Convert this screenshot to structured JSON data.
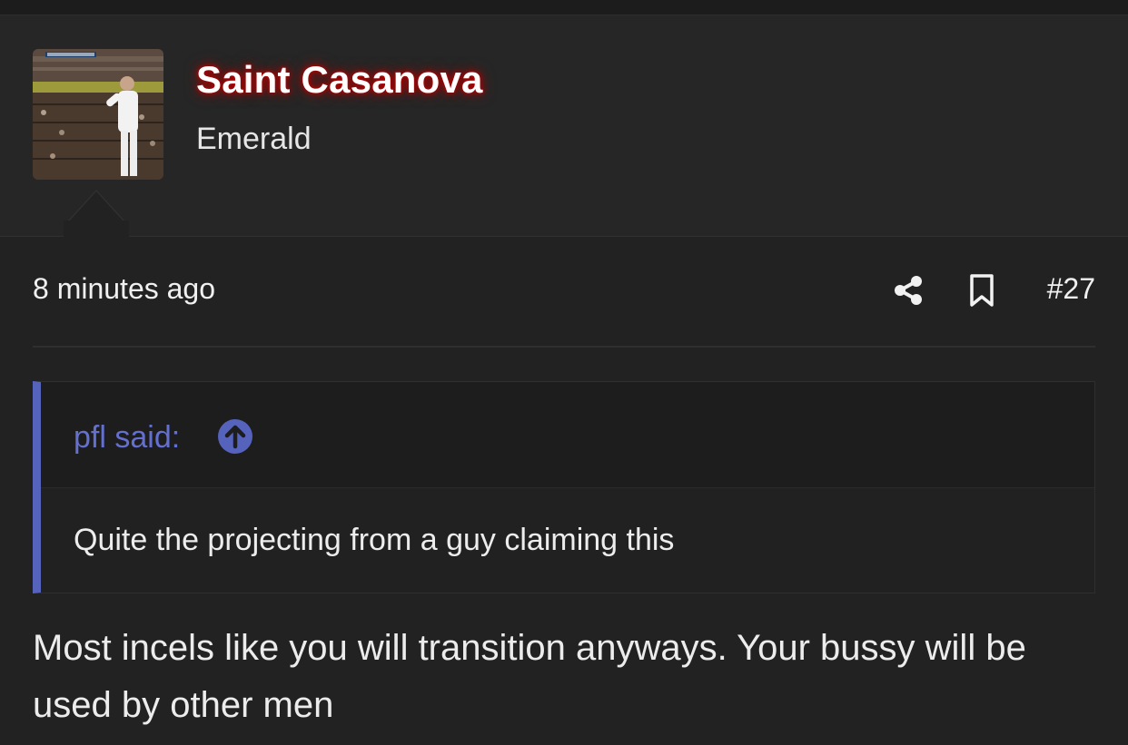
{
  "user": {
    "name": "Saint Casanova",
    "title": "Emerald",
    "avatar_alt": "avatar"
  },
  "meta": {
    "time": "8 minutes ago",
    "share_icon": "share-icon",
    "bookmark_icon": "bookmark-icon",
    "post_number": "#27"
  },
  "quote": {
    "author": "pfl said:",
    "jump_icon": "arrow-up-circle-icon",
    "text": "Quite the projecting from a guy claiming this"
  },
  "post": {
    "text": "Most incels like you will transition anyways. Your bussy will be used by other men"
  },
  "colors": {
    "background": "#222222",
    "header": "#262626",
    "username_glow": "#c40000",
    "quote_accent": "#5663bd",
    "quote_author": "#6470cf"
  }
}
